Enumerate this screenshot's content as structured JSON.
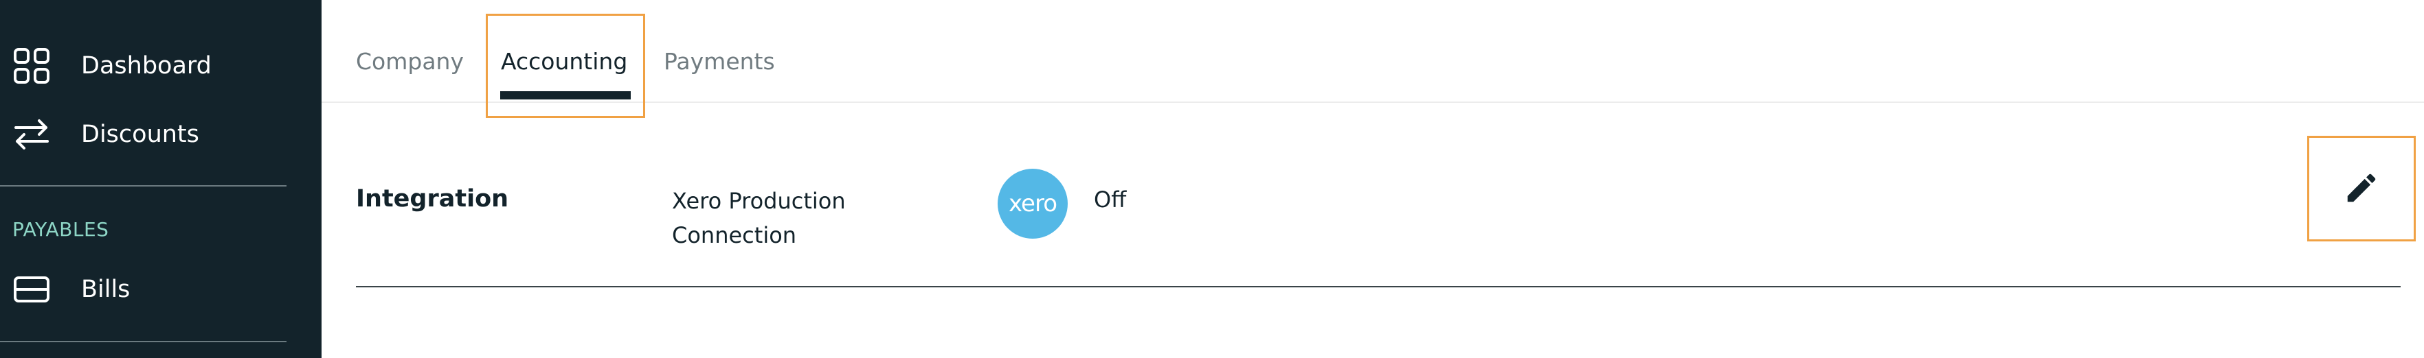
{
  "sidebar": {
    "items": [
      {
        "label": "Dashboard",
        "icon": "grid-icon"
      },
      {
        "label": "Discounts",
        "icon": "arrows-exchange-icon"
      }
    ],
    "sections": [
      {
        "label": "PAYABLES",
        "items": [
          {
            "label": "Bills",
            "icon": "card-icon"
          }
        ]
      }
    ]
  },
  "tabs": [
    {
      "label": "Company",
      "active": false
    },
    {
      "label": "Accounting",
      "active": true
    },
    {
      "label": "Payments",
      "active": false
    }
  ],
  "integration": {
    "title": "Integration",
    "connection_name": "Xero Production Connection",
    "provider_logo_text": "xero",
    "provider_logo_color": "#54b8e6",
    "status": "Off"
  },
  "colors": {
    "sidebar_bg": "#13232b",
    "accent_highlight": "#f0a144",
    "section_label": "#8ed6c6"
  },
  "icons": {
    "edit": "pencil-icon"
  }
}
